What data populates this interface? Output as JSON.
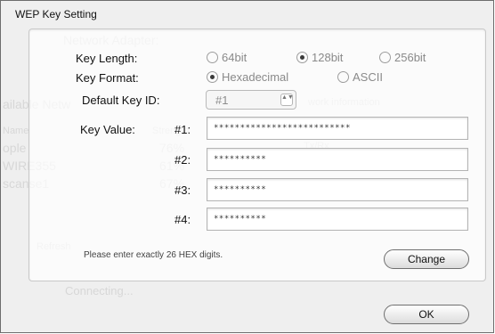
{
  "window": {
    "title": "WEP Key Setting"
  },
  "background_ghosts": {
    "network_adapter": "Network Adapter:",
    "available_networks": "ailable Netw",
    "network_information": "work information",
    "strength_label": "Strength",
    "name_label": "Name",
    "net1": "ople",
    "net2": "WIRE355",
    "net3": "scanse1",
    "pct1": "76%",
    "pct2": "61%",
    "pct3": "67%",
    "refresh": "Refresh",
    "connecting": "Connecting...",
    "tx_rate": "Tx/Rx",
    "wpa": "WEP"
  },
  "key_length": {
    "label": "Key Length:",
    "options": [
      {
        "label": "64bit",
        "selected": false
      },
      {
        "label": "128bit",
        "selected": true
      },
      {
        "label": "256bit",
        "selected": false
      }
    ]
  },
  "key_format": {
    "label": "Key Format:",
    "options": [
      {
        "label": "Hexadecimal",
        "selected": true
      },
      {
        "label": "ASCII",
        "selected": false
      }
    ]
  },
  "default_key_id": {
    "label": "Default Key ID:",
    "value": "#1",
    "arrows": "▲▼"
  },
  "key_value": {
    "label": "Key Value:",
    "keys": [
      {
        "id": "#1:",
        "value": "**************************"
      },
      {
        "id": "#2:",
        "value": "**********"
      },
      {
        "id": "#3:",
        "value": "**********"
      },
      {
        "id": "#4:",
        "value": "**********"
      }
    ]
  },
  "hint": "Please enter exactly 26 HEX digits.",
  "buttons": {
    "change": "Change",
    "ok": "OK"
  }
}
